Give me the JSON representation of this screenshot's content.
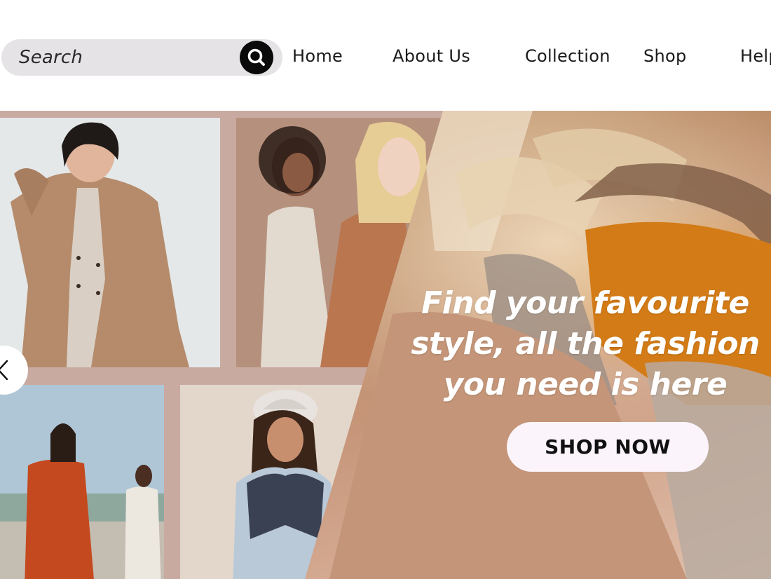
{
  "header": {
    "search": {
      "placeholder": "Search",
      "icon": "search-icon"
    },
    "nav": [
      {
        "label": "Home"
      },
      {
        "label": "About Us"
      },
      {
        "label": "Collection"
      },
      {
        "label": "Shop"
      },
      {
        "label": "Help"
      }
    ]
  },
  "hero": {
    "headline_line1": "Find your favourite",
    "headline_line2": "style, all the fashion",
    "headline_line3": "you need is here",
    "cta_label": "SHOP NOW",
    "prev_icon": "chevron-left-icon",
    "colors": {
      "backdrop": "#c9aaa0",
      "button_bg": "#fbf5fb",
      "headline": "#ffffff"
    }
  }
}
